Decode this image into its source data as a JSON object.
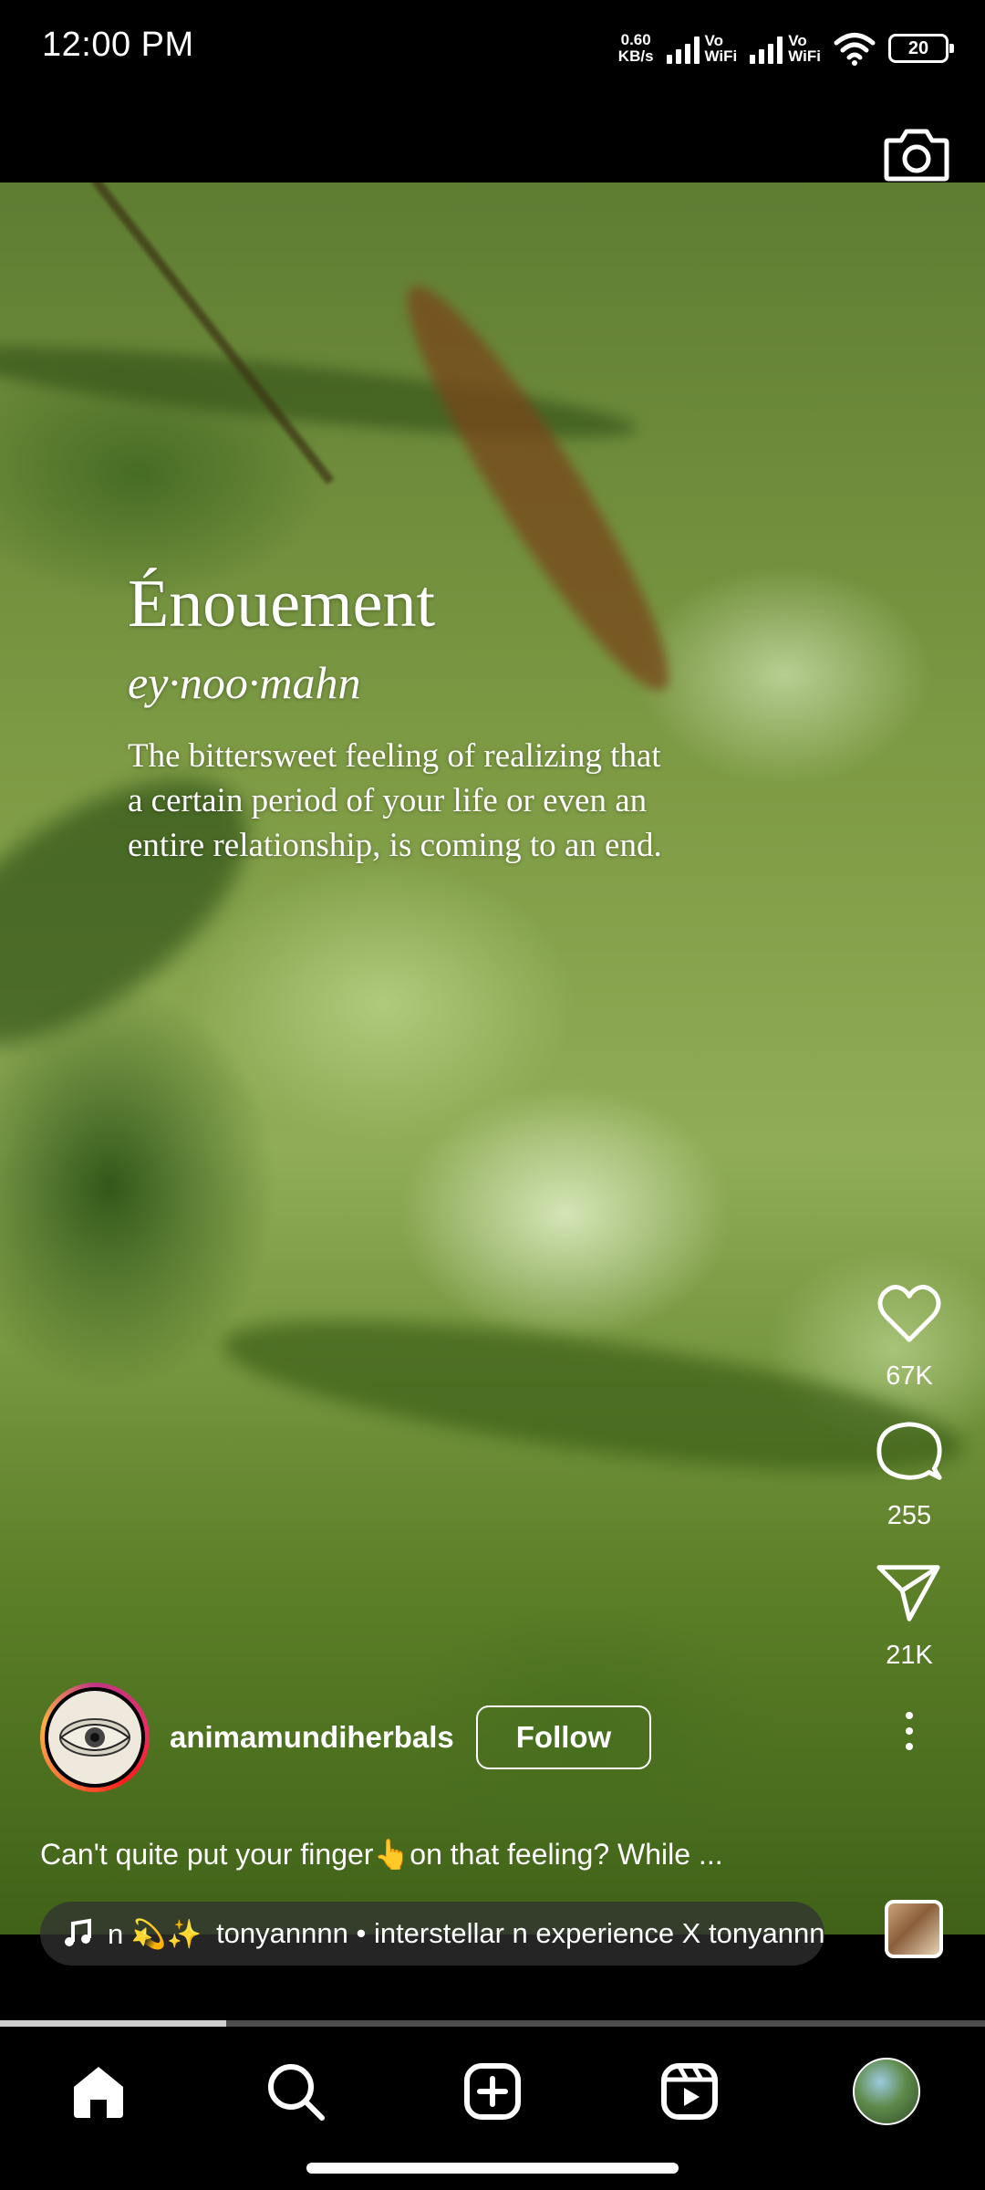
{
  "status_bar": {
    "time": "12:00 PM",
    "net_speed_value": "0.60",
    "net_speed_unit": "KB/s",
    "sim1_label_top": "Vo",
    "sim1_label_bottom": "WiFi",
    "sim2_label_top": "Vo",
    "sim2_label_bottom": "WiFi",
    "battery": "20"
  },
  "reel": {
    "overlay": {
      "title": "Énouement",
      "phonetic": "ey·noo·mahn",
      "definition": "The bittersweet feeling of realizing that a certain period of your life or even an entire relationship, is coming to an end."
    },
    "author": {
      "username": "animamundiherbals",
      "follow_label": "Follow"
    },
    "caption": "Can't quite put your finger👆on that feeling? While ...",
    "music": {
      "prefix": "n 💫✨",
      "track": "tonyannnn • interstellar n experience X tonyannnn"
    },
    "actions": {
      "likes": "67K",
      "comments": "255",
      "shares": "21K"
    },
    "progress_fraction": 0.23
  },
  "icons": {
    "camera": "camera-icon",
    "like": "heart-icon",
    "comment": "comment-bubble-icon",
    "share": "paper-plane-icon",
    "more": "more-vertical-icon",
    "music": "music-note-icon",
    "home": "home-icon",
    "search": "search-icon",
    "create": "plus-square-icon",
    "reels": "reels-icon"
  }
}
